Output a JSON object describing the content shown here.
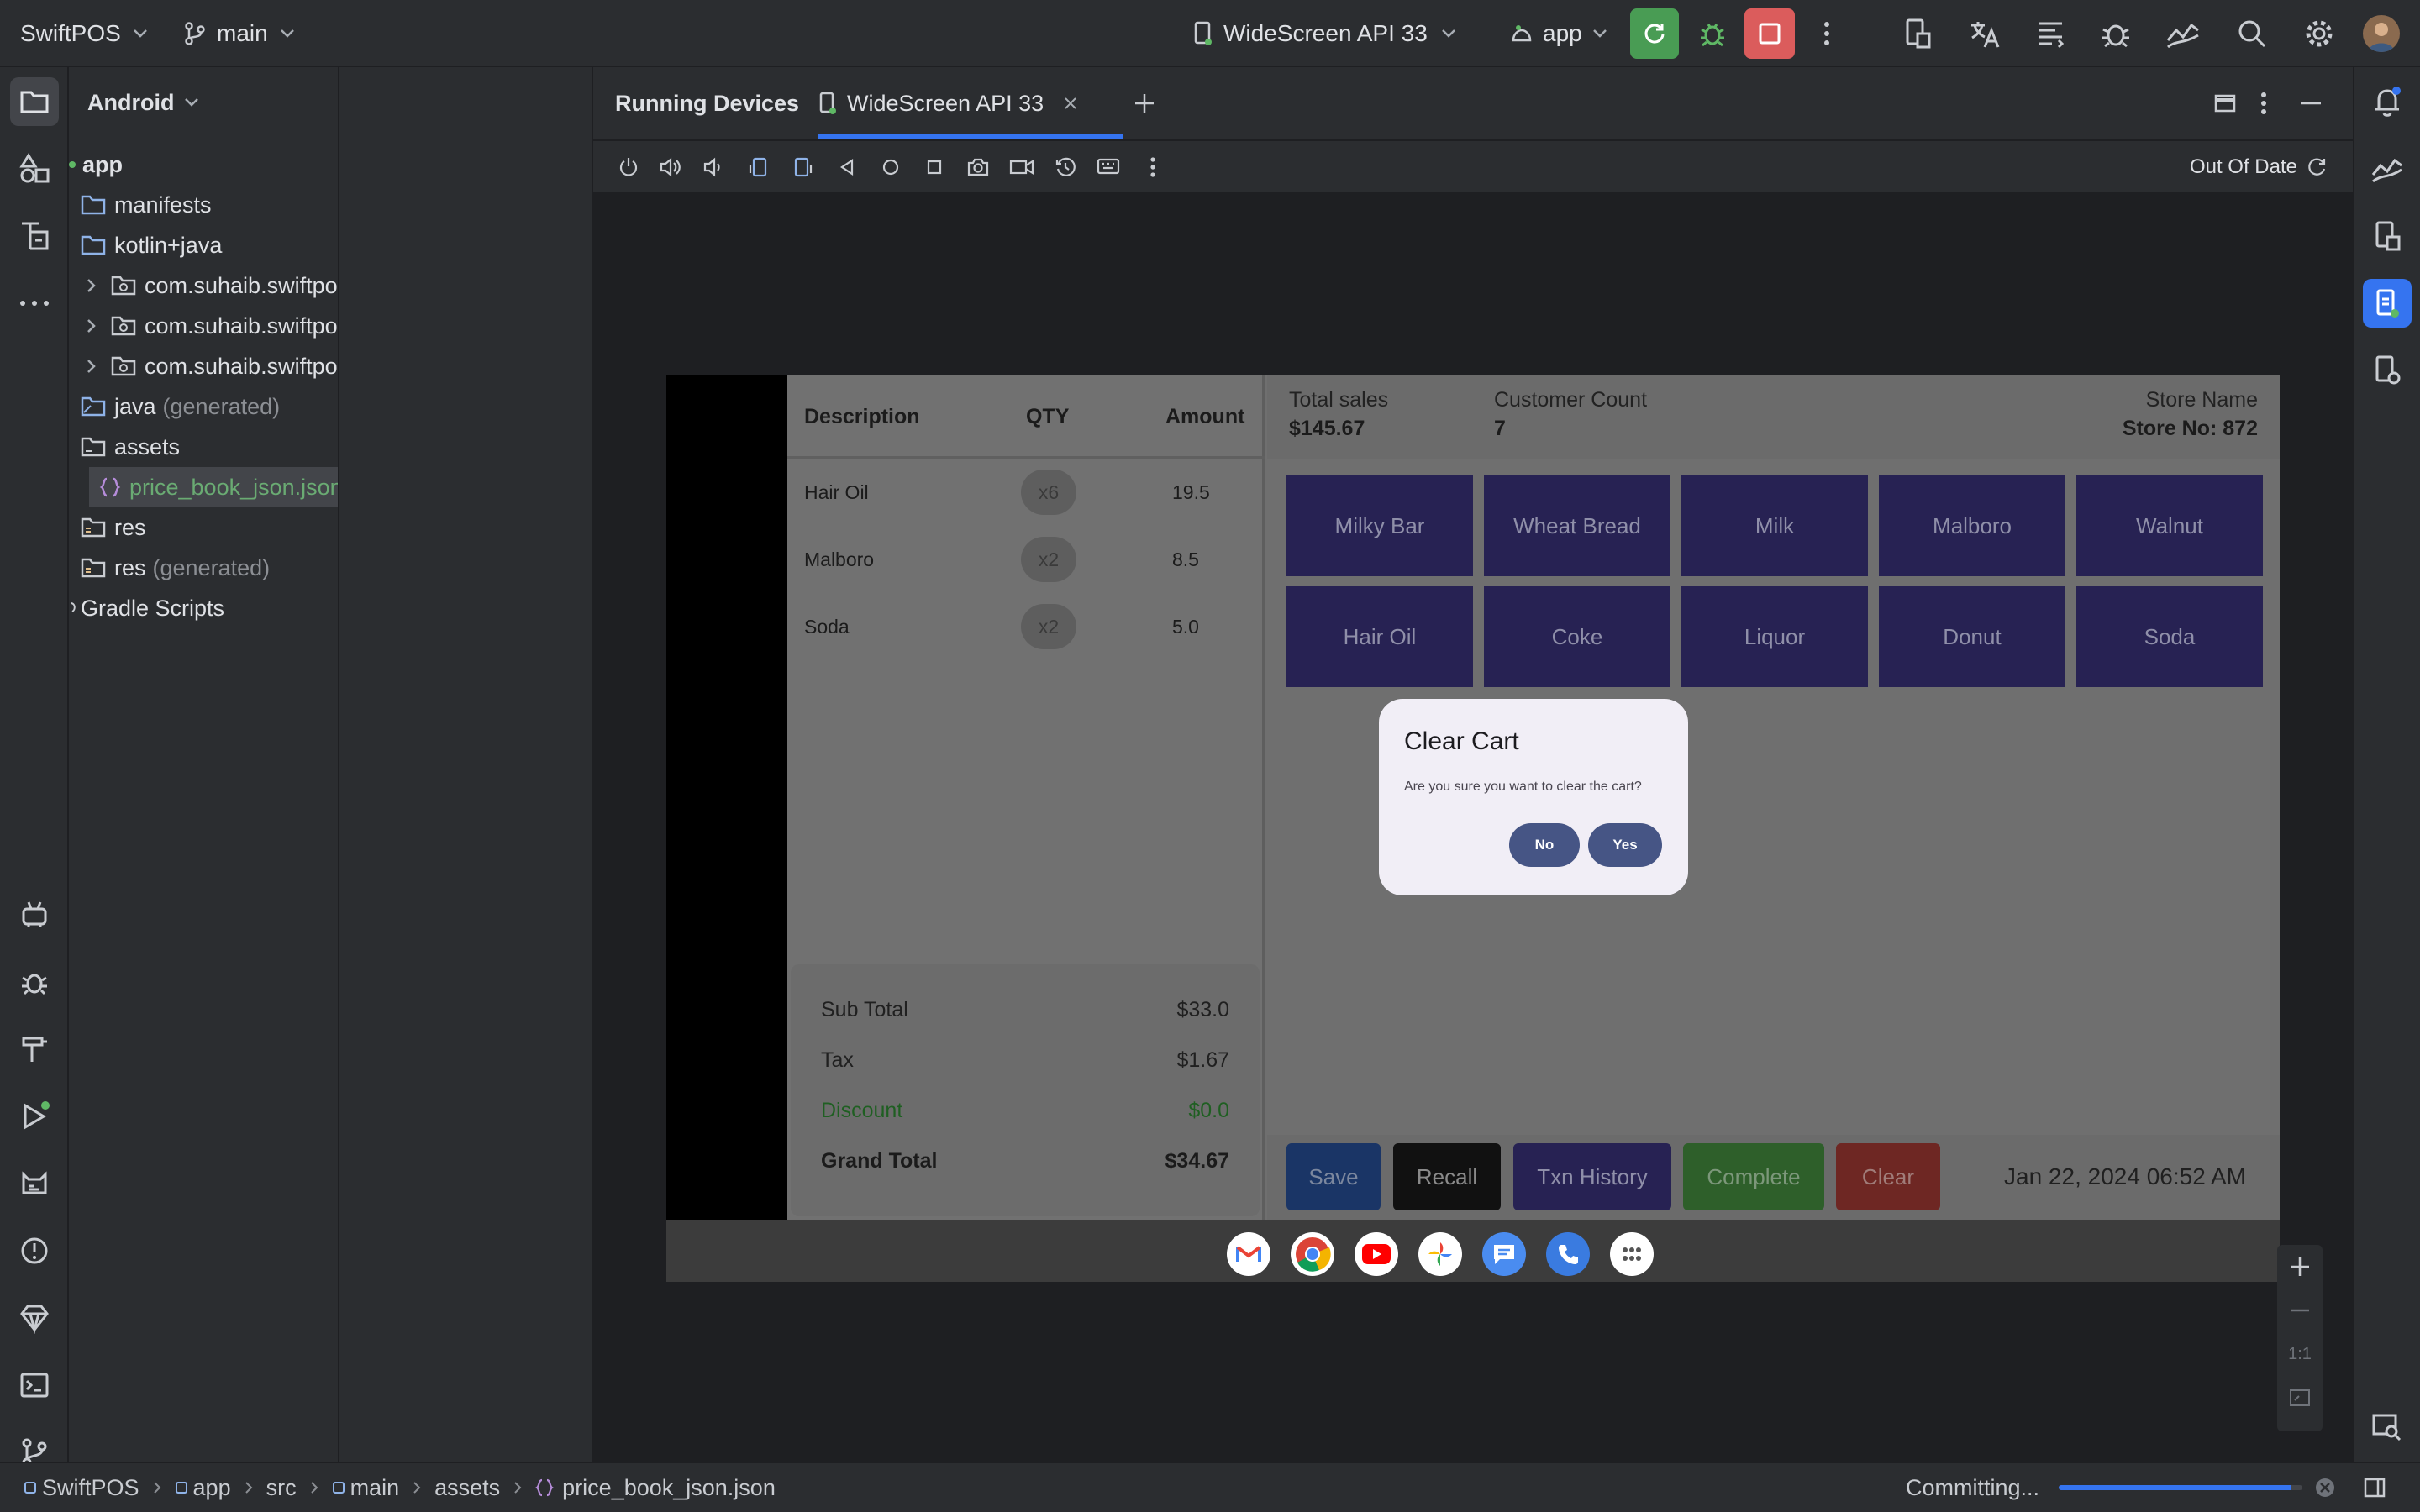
{
  "topbar": {
    "project": "SwiftPOS",
    "branch": "main",
    "device": "WideScreen API 33",
    "run_config": "app"
  },
  "tool_window": {
    "view": "Android",
    "tree": [
      {
        "label": "app"
      },
      {
        "label": "manifests"
      },
      {
        "label": "kotlin+java"
      },
      {
        "label": "com.suhaib.swiftpos"
      },
      {
        "label": "com.suhaib.swiftpos"
      },
      {
        "label": "com.suhaib.swiftpos"
      },
      {
        "label": "java",
        "suffix": "(generated)"
      },
      {
        "label": "assets"
      },
      {
        "label": "price_book_json.json"
      },
      {
        "label": "res"
      },
      {
        "label": "res",
        "suffix": "(generated)"
      },
      {
        "label": "Gradle Scripts"
      }
    ]
  },
  "running_devices": {
    "title": "Running Devices",
    "tab": "WideScreen API 33",
    "status": "Out Of Date"
  },
  "pos": {
    "cart_headers": {
      "description": "Description",
      "qty": "QTY",
      "amount": "Amount"
    },
    "cart": [
      {
        "name": "Hair Oil",
        "qty": "x6",
        "amount": "19.5"
      },
      {
        "name": "Malboro",
        "qty": "x2",
        "amount": "8.5"
      },
      {
        "name": "Soda",
        "qty": "x2",
        "amount": "5.0"
      }
    ],
    "totals": {
      "subtotal_label": "Sub Total",
      "subtotal": "$33.0",
      "tax_label": "Tax",
      "tax": "$1.67",
      "discount_label": "Discount",
      "discount": "$0.0",
      "grand_label": "Grand Total",
      "grand": "$34.67"
    },
    "header": {
      "total_sales_label": "Total sales",
      "total_sales": "$145.67",
      "customer_count_label": "Customer Count",
      "customer_count": "7",
      "store_name_label": "Store Name",
      "store_no": "Store No: 872"
    },
    "products": [
      "Milky Bar",
      "Wheat Bread",
      "Milk",
      "Malboro",
      "Walnut",
      "Hair Oil",
      "Coke",
      "Liquor",
      "Donut",
      "Soda"
    ],
    "actions": [
      "Save",
      "Recall",
      "Txn History",
      "Complete",
      "Clear"
    ],
    "datetime": "Jan 22, 2024 06:52 AM",
    "dialog": {
      "title": "Clear Cart",
      "message": "Are you sure you want to clear the cart?",
      "no": "No",
      "yes": "Yes"
    }
  },
  "zoom": {
    "one_to_one": "1:1"
  },
  "statusbar": {
    "breadcrumbs": [
      "SwiftPOS",
      "app",
      "src",
      "main",
      "assets",
      "price_book_json.json"
    ],
    "task": "Committing...",
    "progress": 0.95
  },
  "colors": {
    "accent": "#3574f0",
    "run_green": "#499c54",
    "stop_red": "#db5c5c",
    "product_tile": "#272253",
    "dialog_button": "#465585"
  }
}
